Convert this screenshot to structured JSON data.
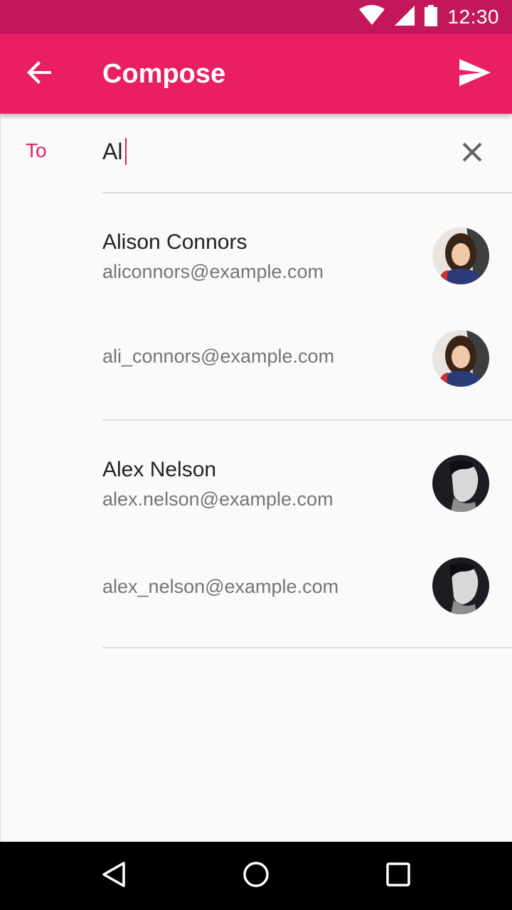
{
  "status_bar": {
    "time": "12:30"
  },
  "app_bar": {
    "title": "Compose"
  },
  "to_field": {
    "label": "To",
    "value": "Al"
  },
  "suggestions": [
    {
      "name": "Alison Connors",
      "email": "aliconnors@example.com",
      "alt_email": "ali_connors@example.com"
    },
    {
      "name": "Alex Nelson",
      "email": "alex.nelson@example.com",
      "alt_email": "alex_nelson@example.com"
    }
  ],
  "colors": {
    "accent": "#e91e63",
    "status_bar": "#c2185b"
  },
  "icons": [
    "wifi-icon",
    "cellular-icon",
    "battery-icon",
    "back-arrow-icon",
    "send-icon",
    "clear-icon",
    "nav-back-icon",
    "nav-home-icon",
    "nav-recents-icon"
  ]
}
